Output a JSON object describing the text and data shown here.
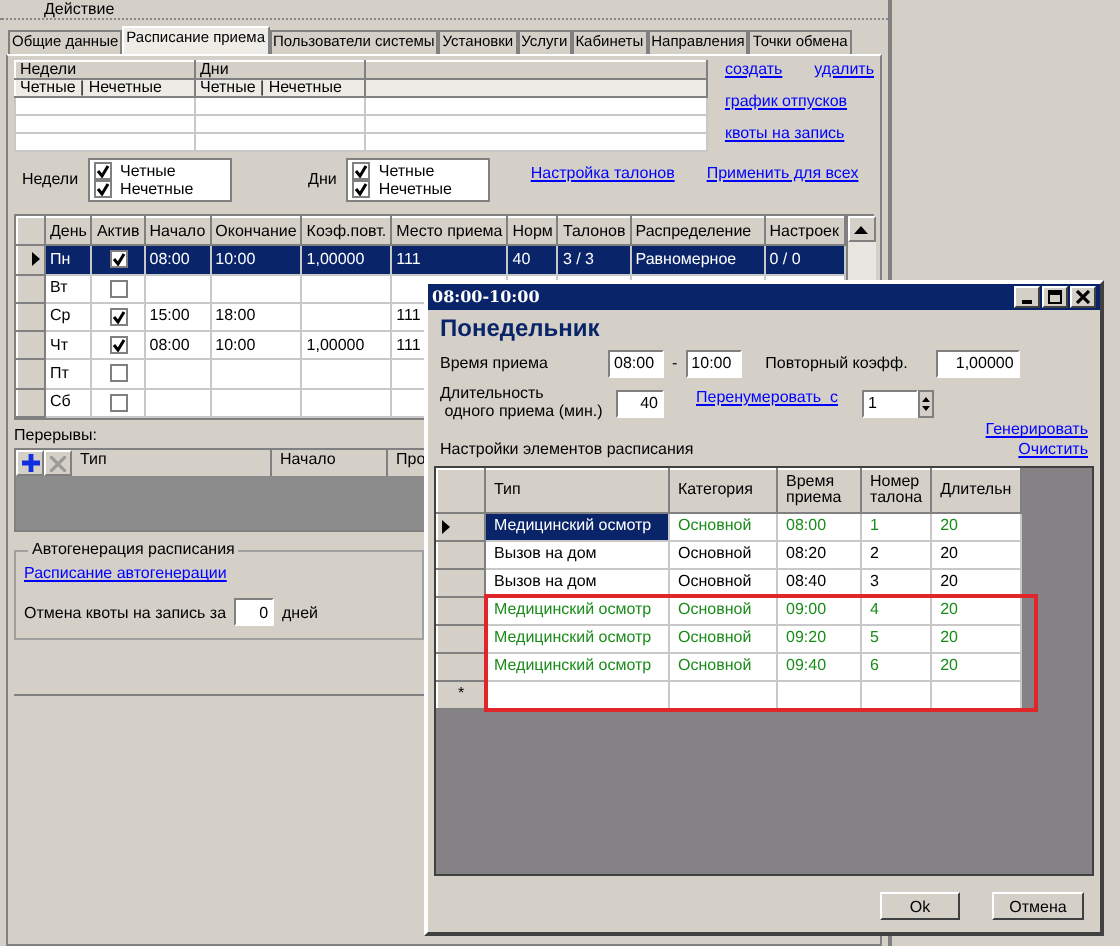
{
  "toolbar": {
    "action_menu": "Действие"
  },
  "tabs": [
    {
      "label": "Общие данные",
      "selected": false
    },
    {
      "label": "Расписание приема",
      "selected": true
    },
    {
      "label": "Пользователи системы",
      "selected": false
    },
    {
      "label": "Установки",
      "selected": false
    },
    {
      "label": "Услуги",
      "selected": false
    },
    {
      "label": "Кабинеты",
      "selected": false
    },
    {
      "label": "Направления",
      "selected": false
    },
    {
      "label": "Точки обмена",
      "selected": false
    }
  ],
  "periods_table": {
    "columns": [
      "Недели",
      "Дни"
    ],
    "subheaders": [
      "Четные | Нечетные",
      "Четные | Нечетные"
    ]
  },
  "period_links": {
    "create": "создать",
    "delete": "удалить",
    "vacations": "график отпусков",
    "quotas": "квоты на запись"
  },
  "weeks": {
    "label": "Недели",
    "options": [
      {
        "label": "Четные",
        "checked": true
      },
      {
        "label": "Нечетные",
        "checked": true
      }
    ]
  },
  "days": {
    "label": "Дни",
    "options": [
      {
        "label": "Четные",
        "checked": true
      },
      {
        "label": "Нечетные",
        "checked": true
      }
    ]
  },
  "settings_links": [
    "Настройка талонов",
    "Применить для всех"
  ],
  "schedule_grid": {
    "columns": [
      "День",
      "Актив",
      "Начало",
      "Окончание",
      "Коэф.повт.",
      "Место приема",
      "Норм",
      "Талонов",
      "Распределение",
      "Настроек"
    ],
    "rows": [
      {
        "selected": true,
        "active": true,
        "cells": {
          "day": "Пн",
          "start": "08:00",
          "end": "10:00",
          "repeat_coef": "1,00000",
          "place": "111",
          "norm": "40",
          "tickets": "3 / 3",
          "distribution": "Равномерное",
          "settings": "0 / 0"
        }
      },
      {
        "selected": false,
        "active": false,
        "cells": {
          "day": "Вт"
        }
      },
      {
        "selected": false,
        "active": true,
        "cells": {
          "day": "Ср",
          "start": "15:00",
          "end": "18:00",
          "place": "111"
        }
      },
      {
        "selected": false,
        "active": true,
        "cells": {
          "day": "Чт",
          "start": "08:00",
          "end": "10:00",
          "repeat_coef": "1,00000",
          "place": "111"
        }
      },
      {
        "selected": false,
        "active": false,
        "cells": {
          "day": "Пт"
        }
      },
      {
        "selected": false,
        "active": false,
        "cells": {
          "day": "Сб"
        }
      }
    ]
  },
  "breaks": {
    "label": "Перерывы:",
    "columns": [
      "Тип",
      "Начало",
      "Про"
    ]
  },
  "autogeneration": {
    "title": "Автогенерация расписания",
    "link": "Расписание автогенерации",
    "quota_label": "Отмена квоты на запись за",
    "quota_value": "0",
    "quota_unit": "дней"
  },
  "dialog": {
    "title": "08:00-10:00",
    "heading": "Понедельник",
    "time_label": "Время приема",
    "time_from": "08:00",
    "time_separator": "-",
    "time_to": "10:00",
    "coef_label": "Повторный коэфф.",
    "coef_value": "1,00000",
    "duration_label": [
      "Длительность",
      "одного приема (мин.)"
    ],
    "duration_value": "40",
    "renumber_link": "Перенумеровать  с",
    "renumber_value": "1",
    "generate_link": "Генерировать",
    "clear_link": "Очистить",
    "settings_label": "Настройки элементов расписания",
    "grid": {
      "columns": [
        "Тип",
        "Категория",
        "Время приема",
        "Номер талона",
        "Длительн"
      ],
      "rows": [
        {
          "selected": true,
          "highlighted": false,
          "color": "#1a8c1a",
          "cells": [
            "Медицинский осмотр",
            "Основной",
            "08:00",
            "1",
            "20"
          ]
        },
        {
          "selected": false,
          "highlighted": false,
          "color": "#000000",
          "cells": [
            "Вызов на дом",
            "Основной",
            "08:20",
            "2",
            "20"
          ]
        },
        {
          "selected": false,
          "highlighted": false,
          "color": "#000000",
          "cells": [
            "Вызов на дом",
            "Основной",
            "08:40",
            "3",
            "20"
          ]
        },
        {
          "selected": false,
          "highlighted": true,
          "color": "#1a8c1a",
          "cells": [
            "Медицинский осмотр",
            "Основной",
            "09:00",
            "4",
            "20"
          ]
        },
        {
          "selected": false,
          "highlighted": true,
          "color": "#1a8c1a",
          "cells": [
            "Медицинский осмотр",
            "Основной",
            "09:20",
            "5",
            "20"
          ]
        },
        {
          "selected": false,
          "highlighted": true,
          "color": "#1a8c1a",
          "cells": [
            "Медицинский осмотр",
            "Основной",
            "09:40",
            "6",
            "20"
          ]
        }
      ],
      "new_row": {
        "marker": "*",
        "highlighted": true
      }
    },
    "buttons": [
      "Ok",
      "Отмена"
    ]
  }
}
